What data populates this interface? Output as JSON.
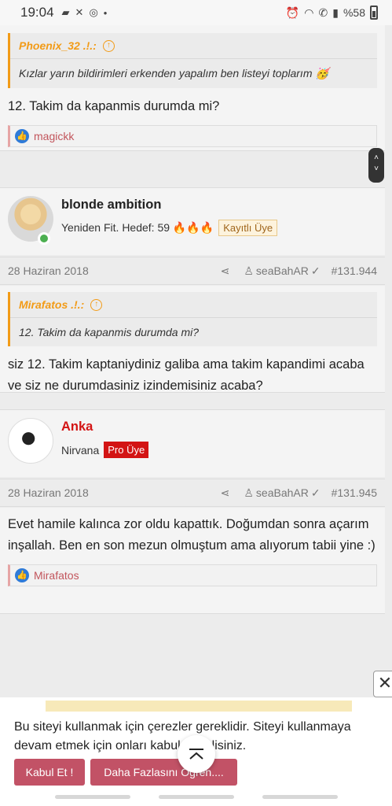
{
  "status_bar": {
    "time": "19:04",
    "battery": "%58",
    "icons": [
      "message-icon",
      "missed-call-icon",
      "instagram-icon",
      "dot-icon",
      "alarm-icon",
      "wifi-icon",
      "call-icon",
      "signal-icon",
      "battery-icon"
    ]
  },
  "post1": {
    "quote_author": "Phoenix_32 .!.:",
    "quote_text": "Kızlar yarın bildirimleri erkenden yapalım ben listeyi toplarım 🥳",
    "text": "12. Takim da kapanmis durumda mi?",
    "reaction_user": "magickk"
  },
  "post2": {
    "username": "blonde ambition",
    "user_title": "Yeniden Fit. Hedef: 59 🔥🔥🔥",
    "badge": "Kayıtlı Üye",
    "date": "28 Haziran 2018",
    "thread_starter": "seaBahAR",
    "post_number": "#131.944",
    "quote_author": "Mirafatos .!.:",
    "quote_text": "12. Takim da kapanmis durumda mi?",
    "text": "siz 12. Takim kaptaniydiniz galiba ama takim kapandimi acaba ve siz ne durumdasiniz izindemisiniz acaba?"
  },
  "post3": {
    "username": "Anka",
    "user_title": "Nirvana",
    "badge": "Pro Üye",
    "date": "28 Haziran 2018",
    "thread_starter": "seaBahAR",
    "post_number": "#131.945",
    "text": "Evet hamile kalınca zor oldu kapattık. Doğumdan sonra açarım inşallah. Ben en son mezun olmuştum ama alıyorum tabii yine :)",
    "reaction_user": "Mirafatos"
  },
  "cookie": {
    "text": "Bu siteyi kullanmak için çerezler gereklidir. Siteyi kullanmaya devam etmek için onları kabul etmelisiniz.",
    "accept_label": "Kabul Et !",
    "learn_more_label": "Daha Fazlasını Öğren...."
  },
  "colors": {
    "quote_accent": "#f29b17",
    "reaction_text": "#c2555c",
    "pro_badge": "#d31414",
    "cookie_button": "#c25266",
    "like": "#2f7bd8"
  }
}
